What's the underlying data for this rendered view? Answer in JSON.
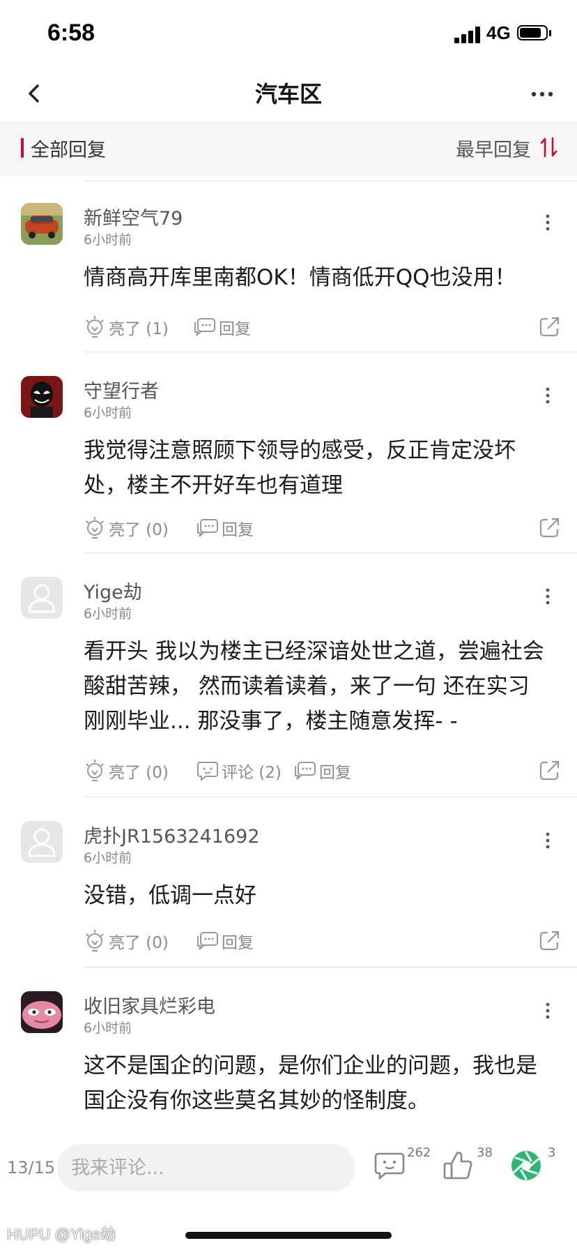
{
  "status_bar": {
    "time": "6:58",
    "network": "4G"
  },
  "nav": {
    "title": "汽车区"
  },
  "sort_bar": {
    "title": "全部回复",
    "order": "最早回复"
  },
  "comments": [
    {
      "username": "新鲜空气79",
      "time": "6小时前",
      "body": "情商高开库里南都OK！情商低开QQ也没用！",
      "light": "亮了 (1)",
      "comment_count": "",
      "reply": "回复"
    },
    {
      "username": "守望行者",
      "time": "6小时前",
      "body": "我觉得注意照顾下领导的感受，反正肯定没坏处，楼主不开好车也有道理",
      "light": "亮了 (0)",
      "comment_count": "",
      "reply": "回复"
    },
    {
      "username": "Yige劫",
      "time": "6小时前",
      "body": "看开头 我以为楼主已经深谙处世之道，尝遍社会酸甜苦辣， 然而读着读着，来了一句 还在实习 刚刚毕业... 那没事了，楼主随意发挥- -",
      "light": "亮了 (0)",
      "comment_count": "评论 (2)",
      "reply": "回复"
    },
    {
      "username": "虎扑JR1563241692",
      "time": "6小时前",
      "body": "没错，低调一点好",
      "light": "亮了 (0)",
      "comment_count": "",
      "reply": "回复"
    },
    {
      "username": "收旧家具烂彩电",
      "time": "6小时前",
      "body": "这不是国企的问题，是你们企业的问题，我也是国企没有你这些莫名其妙的怪制度。",
      "light": "",
      "comment_count": "",
      "reply": ""
    }
  ],
  "bottom_bar": {
    "page_indicator": "13/15",
    "input_placeholder": "我来评论...",
    "comments_count": "262",
    "likes_count": "38",
    "share_count": "3"
  },
  "watermark": "HUPU @Yige劫",
  "colors": {
    "accent": "#c8102e",
    "share_green": "#2bb673"
  }
}
